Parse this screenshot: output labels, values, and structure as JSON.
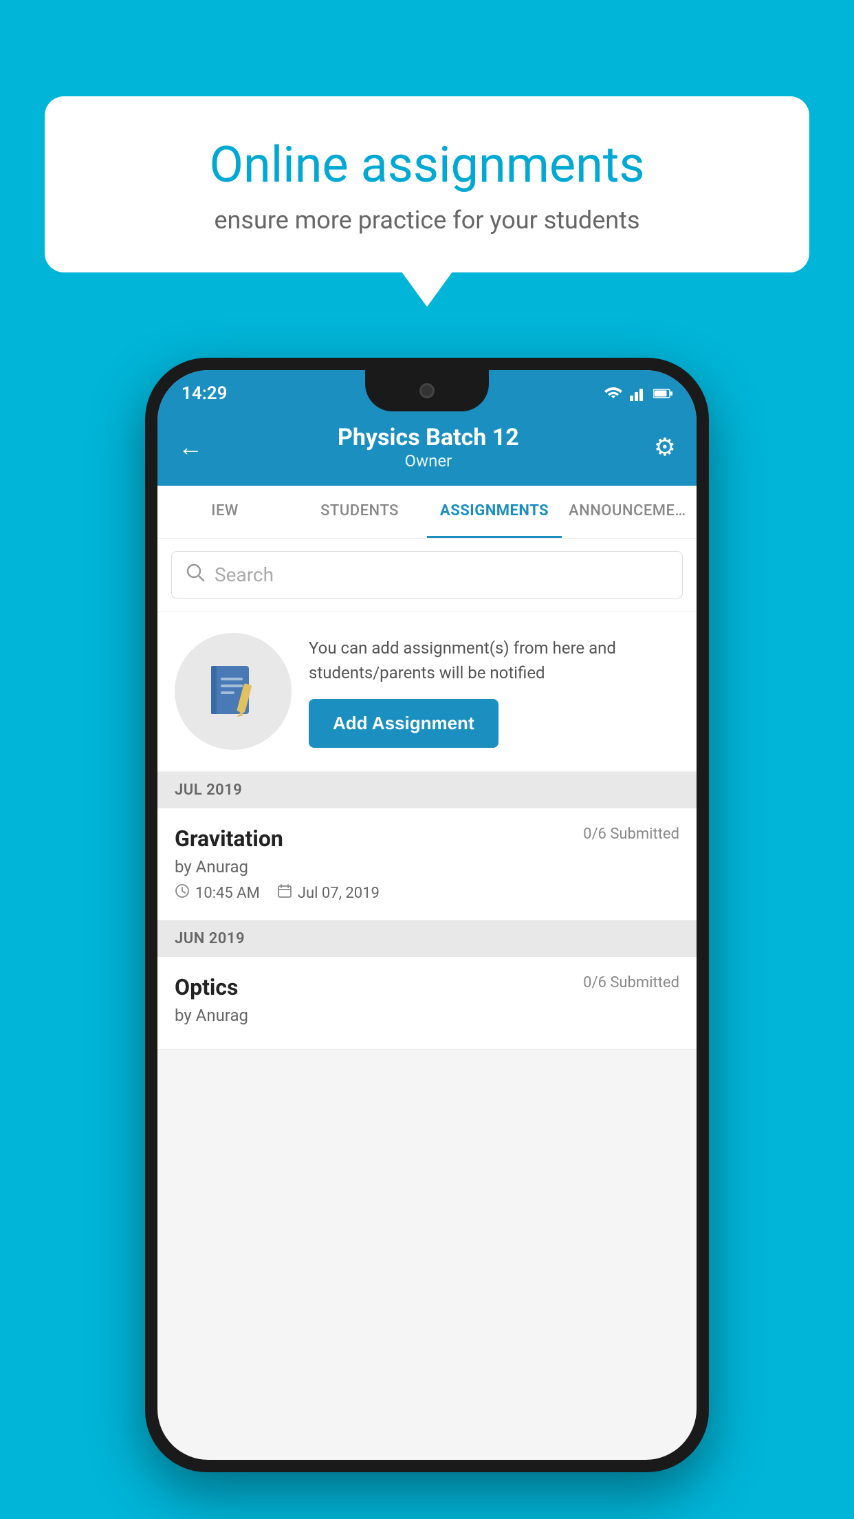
{
  "background_color": "#00b5d8",
  "speech_bubble": {
    "title": "Online assignments",
    "subtitle": "ensure more practice for your students"
  },
  "status_bar": {
    "time": "14:29",
    "wifi": "▲",
    "signal": "▲",
    "battery": "▮"
  },
  "header": {
    "title": "Physics Batch 12",
    "subtitle": "Owner",
    "back_label": "←",
    "gear_label": "⚙"
  },
  "tabs": [
    {
      "label": "IEW",
      "active": false
    },
    {
      "label": "STUDENTS",
      "active": false
    },
    {
      "label": "ASSIGNMENTS",
      "active": true
    },
    {
      "label": "ANNOUNCEMENTS",
      "active": false
    }
  ],
  "search": {
    "placeholder": "Search"
  },
  "promo": {
    "text": "You can add assignment(s) from here and students/parents will be notified",
    "button_label": "Add Assignment"
  },
  "assignments": {
    "sections": [
      {
        "month": "JUL 2019",
        "items": [
          {
            "name": "Gravitation",
            "submitted": "0/6 Submitted",
            "by": "by Anurag",
            "time": "10:45 AM",
            "date": "Jul 07, 2019"
          }
        ]
      },
      {
        "month": "JUN 2019",
        "items": [
          {
            "name": "Optics",
            "submitted": "0/6 Submitted",
            "by": "by Anurag",
            "time": "",
            "date": ""
          }
        ]
      }
    ]
  }
}
